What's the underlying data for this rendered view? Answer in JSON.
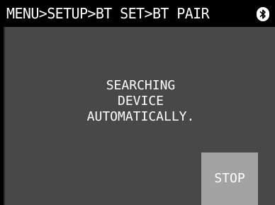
{
  "header": {
    "breadcrumb": "MENU>SETUP>BT SET>BT PAIR",
    "status_icon": "bluetooth-icon"
  },
  "message": {
    "lines": [
      "SEARCHING",
      "DEVICE",
      "AUTOMATICALLY."
    ]
  },
  "actions": {
    "stop_label": "STOP"
  },
  "colors": {
    "header_bg": "#000000",
    "panel_bg": "#484848",
    "button_bg": "#a3a3a3",
    "text": "#ffffff"
  }
}
